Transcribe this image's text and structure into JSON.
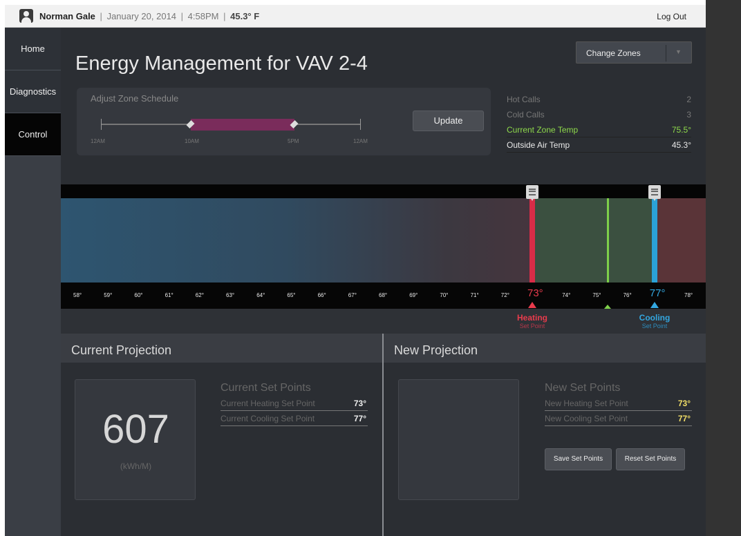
{
  "topbar": {
    "user_name": "Norman Gale",
    "separator": "|",
    "date": "January 20, 2014",
    "time": "4:58PM",
    "temperature": "45.3° F",
    "logout_label": "Log Out"
  },
  "sidebar": {
    "items": [
      {
        "label": "Home"
      },
      {
        "label": "Diagnostics"
      },
      {
        "label": "Control",
        "active": true
      }
    ]
  },
  "main": {
    "title": "Energy Management for VAV 2-4",
    "change_zones_label": "Change Zones",
    "change_zones_arrow": "▼"
  },
  "schedule": {
    "title": "Adjust Zone Schedule",
    "labels": [
      "12AM",
      "10AM",
      "5PM",
      "12AM"
    ],
    "update_label": "Update"
  },
  "stats": {
    "hot_calls": {
      "label": "Hot Calls",
      "value": "2"
    },
    "cold_calls": {
      "label": "Cold Calls",
      "value": "3"
    },
    "zone_temp": {
      "label": "Current Zone Temp",
      "value": "75.5°"
    },
    "outside_temp": {
      "label": "Outside Air Temp",
      "value": "45.3°"
    }
  },
  "temperature_band": {
    "ticks": [
      "58°",
      "59°",
      "60°",
      "61°",
      "62°",
      "63°",
      "64°",
      "65°",
      "66°",
      "67°",
      "68°",
      "69°",
      "70°",
      "71°",
      "72°",
      "73°",
      "74°",
      "75°",
      "76°",
      "77°",
      "78°"
    ],
    "heating": {
      "value": "73°",
      "title": "Heating",
      "subtitle": "Set Point",
      "color": "#e83b4c"
    },
    "cooling": {
      "value": "77°",
      "title": "Cooling",
      "subtitle": "Set Point",
      "color": "#33a7e0"
    },
    "zone_color": "#7ed04a"
  },
  "current_projection": {
    "title": "Current Projection",
    "value": "607",
    "unit": "(kWh/M)",
    "set_points_title": "Current Set Points",
    "heating": {
      "label": "Current Heating Set Point",
      "value": "73°"
    },
    "cooling": {
      "label": "Current Cooling Set Point",
      "value": "77°"
    }
  },
  "new_projection": {
    "title": "New Projection",
    "set_points_title": "New Set Points",
    "heating": {
      "label": "New Heating Set Point",
      "value": "73°"
    },
    "cooling": {
      "label": "New Cooling Set Point",
      "value": "77°"
    },
    "save_label": "Save Set Points",
    "reset_label": "Reset Set Points"
  }
}
